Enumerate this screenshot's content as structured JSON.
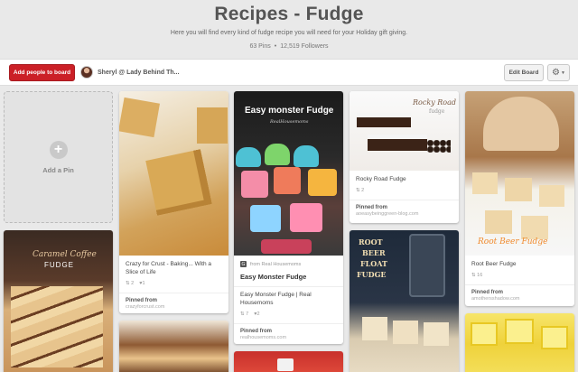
{
  "header": {
    "title": "Recipes - Fudge",
    "description": "Here you will find every kind of fudge recipe you will need for your Holiday gift giving.",
    "pins": "63 Pins",
    "separator": "•",
    "followers": "12,519 Followers"
  },
  "toolbar": {
    "add_people_label": "Add people to board",
    "owner_name": "Sheryl @ Lady Behind Th...",
    "edit_board_label": "Edit Board"
  },
  "add_pin": {
    "label": "Add a Pin",
    "icon": "plus-icon"
  },
  "pins": [
    {
      "description": "Crazy for Crust - Baking... With a Slice of Life",
      "repins": "2",
      "likes": "1",
      "pinned_from_label": "Pinned from",
      "source": "crazyforcrust.com"
    },
    {
      "via": "from Real Housemoms",
      "rich_title": "Easy Monster Fudge",
      "image_text": "Easy monster Fudge",
      "image_subtext": "RealHousemoms",
      "description": "Easy Monster Fudge | Real Housemoms",
      "repins": "7",
      "likes": "2",
      "pinned_from_label": "Pinned from",
      "source": "realhousemoms.com"
    },
    {
      "image_text_1": "Rocky Road",
      "image_text_2": "fudge",
      "description": "Rocky Road Fudge",
      "repins": "2",
      "pinned_from_label": "Pinned from",
      "source": "aoeasybeinggreen-blog.com"
    },
    {
      "image_text": "Root Beer Fudge",
      "description": "Root Beer Fudge",
      "repins": "16",
      "pinned_from_label": "Pinned from",
      "source": "amothersshadow.com"
    },
    {
      "image_text_1": "Caramel Coffee",
      "image_text_2": "FUDGE"
    },
    {
      "image_text_1": "ROOT",
      "image_text_2": "BEER",
      "image_text_3": "FLOAT",
      "image_text_4": "FUDGE"
    }
  ],
  "colors": {
    "brand_red": "#cb2027",
    "background": "#e9e9e9"
  }
}
